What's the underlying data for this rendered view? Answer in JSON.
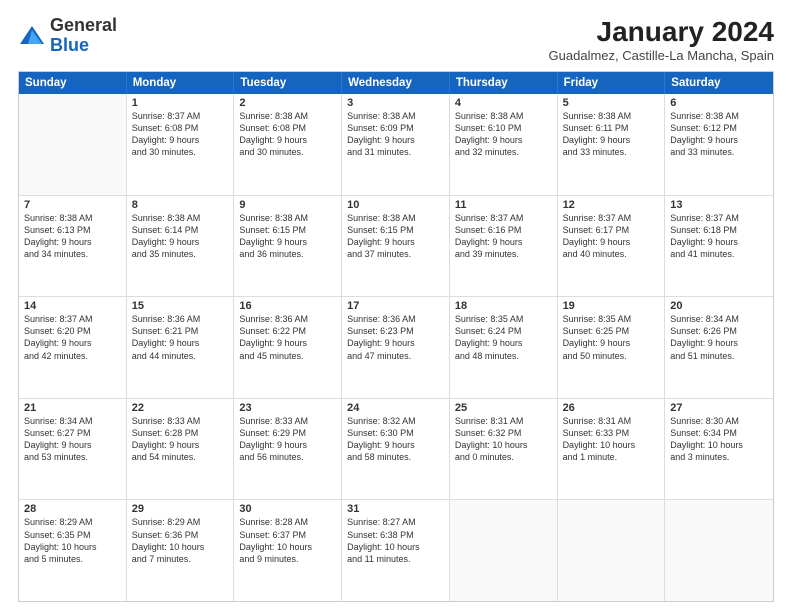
{
  "logo": {
    "general": "General",
    "blue": "Blue"
  },
  "title": "January 2024",
  "subtitle": "Guadalmez, Castille-La Mancha, Spain",
  "header_days": [
    "Sunday",
    "Monday",
    "Tuesday",
    "Wednesday",
    "Thursday",
    "Friday",
    "Saturday"
  ],
  "rows": [
    [
      {
        "day": "",
        "lines": []
      },
      {
        "day": "1",
        "lines": [
          "Sunrise: 8:37 AM",
          "Sunset: 6:08 PM",
          "Daylight: 9 hours",
          "and 30 minutes."
        ]
      },
      {
        "day": "2",
        "lines": [
          "Sunrise: 8:38 AM",
          "Sunset: 6:08 PM",
          "Daylight: 9 hours",
          "and 30 minutes."
        ]
      },
      {
        "day": "3",
        "lines": [
          "Sunrise: 8:38 AM",
          "Sunset: 6:09 PM",
          "Daylight: 9 hours",
          "and 31 minutes."
        ]
      },
      {
        "day": "4",
        "lines": [
          "Sunrise: 8:38 AM",
          "Sunset: 6:10 PM",
          "Daylight: 9 hours",
          "and 32 minutes."
        ]
      },
      {
        "day": "5",
        "lines": [
          "Sunrise: 8:38 AM",
          "Sunset: 6:11 PM",
          "Daylight: 9 hours",
          "and 33 minutes."
        ]
      },
      {
        "day": "6",
        "lines": [
          "Sunrise: 8:38 AM",
          "Sunset: 6:12 PM",
          "Daylight: 9 hours",
          "and 33 minutes."
        ]
      }
    ],
    [
      {
        "day": "7",
        "lines": [
          "Sunrise: 8:38 AM",
          "Sunset: 6:13 PM",
          "Daylight: 9 hours",
          "and 34 minutes."
        ]
      },
      {
        "day": "8",
        "lines": [
          "Sunrise: 8:38 AM",
          "Sunset: 6:14 PM",
          "Daylight: 9 hours",
          "and 35 minutes."
        ]
      },
      {
        "day": "9",
        "lines": [
          "Sunrise: 8:38 AM",
          "Sunset: 6:15 PM",
          "Daylight: 9 hours",
          "and 36 minutes."
        ]
      },
      {
        "day": "10",
        "lines": [
          "Sunrise: 8:38 AM",
          "Sunset: 6:15 PM",
          "Daylight: 9 hours",
          "and 37 minutes."
        ]
      },
      {
        "day": "11",
        "lines": [
          "Sunrise: 8:37 AM",
          "Sunset: 6:16 PM",
          "Daylight: 9 hours",
          "and 39 minutes."
        ]
      },
      {
        "day": "12",
        "lines": [
          "Sunrise: 8:37 AM",
          "Sunset: 6:17 PM",
          "Daylight: 9 hours",
          "and 40 minutes."
        ]
      },
      {
        "day": "13",
        "lines": [
          "Sunrise: 8:37 AM",
          "Sunset: 6:18 PM",
          "Daylight: 9 hours",
          "and 41 minutes."
        ]
      }
    ],
    [
      {
        "day": "14",
        "lines": [
          "Sunrise: 8:37 AM",
          "Sunset: 6:20 PM",
          "Daylight: 9 hours",
          "and 42 minutes."
        ]
      },
      {
        "day": "15",
        "lines": [
          "Sunrise: 8:36 AM",
          "Sunset: 6:21 PM",
          "Daylight: 9 hours",
          "and 44 minutes."
        ]
      },
      {
        "day": "16",
        "lines": [
          "Sunrise: 8:36 AM",
          "Sunset: 6:22 PM",
          "Daylight: 9 hours",
          "and 45 minutes."
        ]
      },
      {
        "day": "17",
        "lines": [
          "Sunrise: 8:36 AM",
          "Sunset: 6:23 PM",
          "Daylight: 9 hours",
          "and 47 minutes."
        ]
      },
      {
        "day": "18",
        "lines": [
          "Sunrise: 8:35 AM",
          "Sunset: 6:24 PM",
          "Daylight: 9 hours",
          "and 48 minutes."
        ]
      },
      {
        "day": "19",
        "lines": [
          "Sunrise: 8:35 AM",
          "Sunset: 6:25 PM",
          "Daylight: 9 hours",
          "and 50 minutes."
        ]
      },
      {
        "day": "20",
        "lines": [
          "Sunrise: 8:34 AM",
          "Sunset: 6:26 PM",
          "Daylight: 9 hours",
          "and 51 minutes."
        ]
      }
    ],
    [
      {
        "day": "21",
        "lines": [
          "Sunrise: 8:34 AM",
          "Sunset: 6:27 PM",
          "Daylight: 9 hours",
          "and 53 minutes."
        ]
      },
      {
        "day": "22",
        "lines": [
          "Sunrise: 8:33 AM",
          "Sunset: 6:28 PM",
          "Daylight: 9 hours",
          "and 54 minutes."
        ]
      },
      {
        "day": "23",
        "lines": [
          "Sunrise: 8:33 AM",
          "Sunset: 6:29 PM",
          "Daylight: 9 hours",
          "and 56 minutes."
        ]
      },
      {
        "day": "24",
        "lines": [
          "Sunrise: 8:32 AM",
          "Sunset: 6:30 PM",
          "Daylight: 9 hours",
          "and 58 minutes."
        ]
      },
      {
        "day": "25",
        "lines": [
          "Sunrise: 8:31 AM",
          "Sunset: 6:32 PM",
          "Daylight: 10 hours",
          "and 0 minutes."
        ]
      },
      {
        "day": "26",
        "lines": [
          "Sunrise: 8:31 AM",
          "Sunset: 6:33 PM",
          "Daylight: 10 hours",
          "and 1 minute."
        ]
      },
      {
        "day": "27",
        "lines": [
          "Sunrise: 8:30 AM",
          "Sunset: 6:34 PM",
          "Daylight: 10 hours",
          "and 3 minutes."
        ]
      }
    ],
    [
      {
        "day": "28",
        "lines": [
          "Sunrise: 8:29 AM",
          "Sunset: 6:35 PM",
          "Daylight: 10 hours",
          "and 5 minutes."
        ]
      },
      {
        "day": "29",
        "lines": [
          "Sunrise: 8:29 AM",
          "Sunset: 6:36 PM",
          "Daylight: 10 hours",
          "and 7 minutes."
        ]
      },
      {
        "day": "30",
        "lines": [
          "Sunrise: 8:28 AM",
          "Sunset: 6:37 PM",
          "Daylight: 10 hours",
          "and 9 minutes."
        ]
      },
      {
        "day": "31",
        "lines": [
          "Sunrise: 8:27 AM",
          "Sunset: 6:38 PM",
          "Daylight: 10 hours",
          "and 11 minutes."
        ]
      },
      {
        "day": "",
        "lines": []
      },
      {
        "day": "",
        "lines": []
      },
      {
        "day": "",
        "lines": []
      }
    ]
  ]
}
